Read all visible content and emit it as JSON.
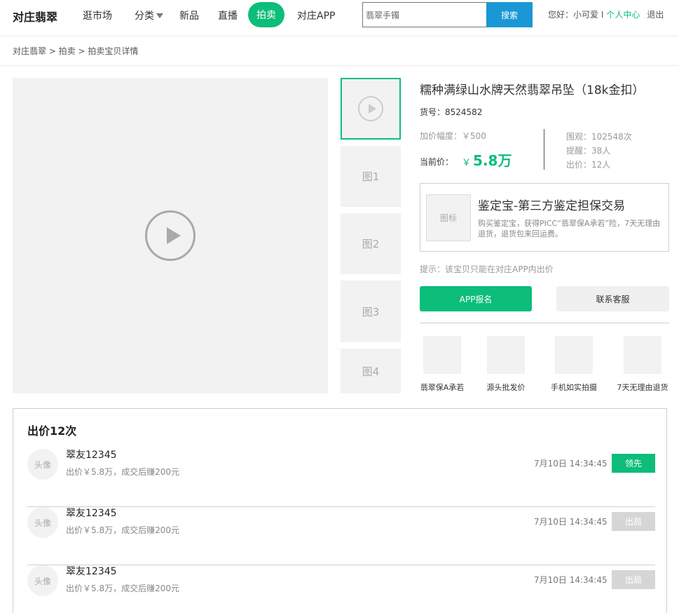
{
  "header": {
    "logo": "对庄翡翠",
    "nav": {
      "market": "逛市场",
      "category": "分类",
      "new": "新品",
      "live": "直播",
      "auction": "拍卖",
      "app": "对庄APP"
    },
    "search": {
      "value": "翡翠手镯",
      "button": "搜索"
    },
    "user": {
      "greeting": "您好：小可爱 I",
      "center": "个人中心",
      "logout": "退出"
    }
  },
  "breadcrumb": "对庄翡翠 > 拍卖 > 拍卖宝贝详情",
  "gallery": {
    "thumbs": [
      "图1",
      "图2",
      "图3",
      "图4"
    ]
  },
  "product": {
    "title": "糯种满绿山水牌天然翡翠吊坠（18k金扣）",
    "item_no": "货号：8524582",
    "increment": "加价幅度：￥500",
    "current_label": "当前价：",
    "current_currency": "￥",
    "current_value": "5.8万",
    "stats": {
      "views": "围观：102548次",
      "reminders": "提醒：38人",
      "bids": "出价：12人"
    },
    "jdb": {
      "icon": "图标",
      "title": "鉴定宝-第三方鉴定担保交易",
      "desc": "购买鉴定宝，获得PICC“翡翠保A承若”险，7天无理由退货，退货包来回运费。"
    },
    "tip": "提示：该宝贝只能在对庄APP内出价",
    "btn_app": "APP报名",
    "btn_service": "联系客服",
    "features": [
      "翡翠保A承若",
      "源头批发价",
      "手机如实拍摄",
      "7天无理由退货"
    ]
  },
  "bids": {
    "title": "出价12次",
    "rows": [
      {
        "avatar": "头像",
        "user": "翠友12345",
        "desc": "出价￥5.8万，成交后赚200元",
        "time": "7月10日 14:34:45",
        "badge": "领先",
        "status": "lead"
      },
      {
        "avatar": "头像",
        "user": "翠友12345",
        "desc": "出价￥5.8万，成交后赚200元",
        "time": "7月10日 14:34:45",
        "badge": "出局",
        "status": "out"
      },
      {
        "avatar": "头像",
        "user": "翠友12345",
        "desc": "出价￥5.8万，成交后赚200元",
        "time": "7月10日 14:34:45",
        "badge": "出局",
        "status": "out"
      }
    ]
  },
  "colors": {
    "accent": "#0dbd7a",
    "search_button": "#1a98d5",
    "placeholder_bg": "#f2f2f2"
  },
  "icons": {
    "play": "play-icon",
    "caret": "caret-down-icon"
  }
}
